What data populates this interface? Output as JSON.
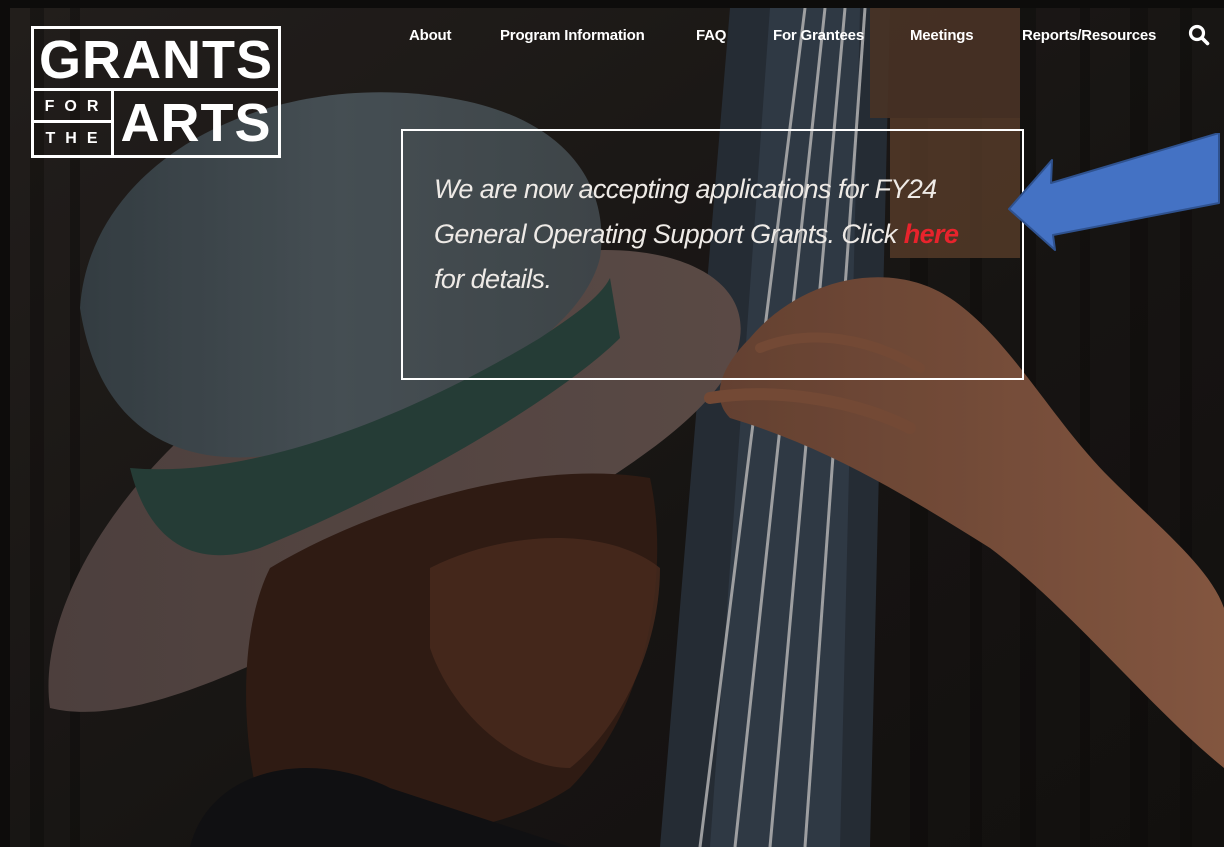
{
  "logo": {
    "line1": "GRANTS",
    "for": "FOR",
    "the": "THE",
    "arts": "ARTS"
  },
  "nav": {
    "items": [
      "About",
      "Program Information",
      "FAQ",
      "For Grantees",
      "Meetings",
      "Reports/Resources"
    ],
    "search_icon": "search-icon"
  },
  "announcement": {
    "line1": "We are now accepting applications for FY24",
    "line2_prefix": "General Operating Support Grants. Click ",
    "link_text": "here",
    "line3": "for details."
  },
  "colors": {
    "link": "#e8232c",
    "arrow": "#4472c4",
    "text": "#ffffff"
  }
}
